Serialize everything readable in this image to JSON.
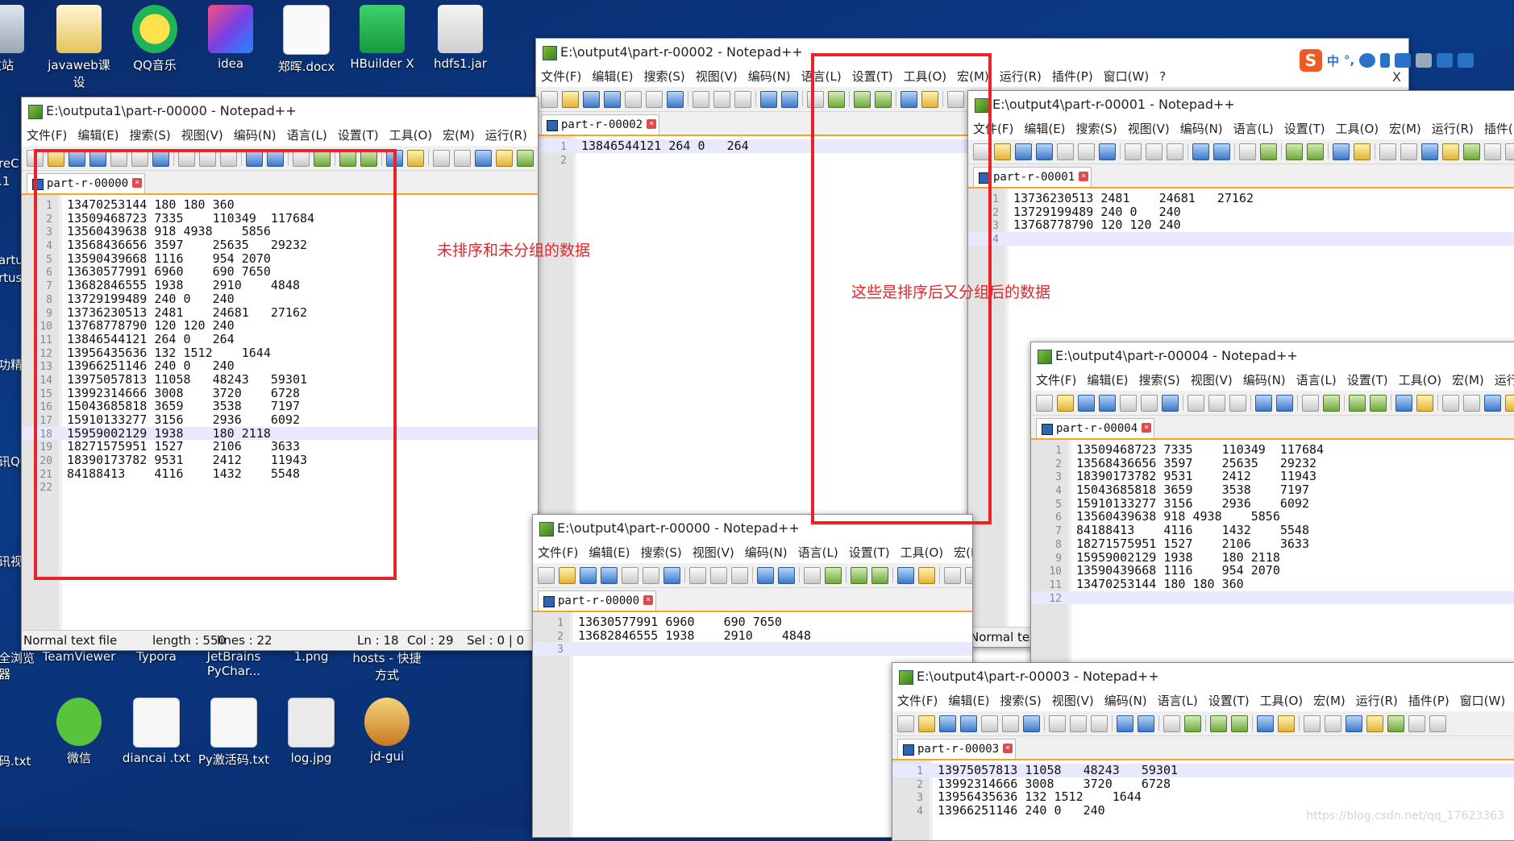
{
  "desktop_top_icons": [
    {
      "label": "收站",
      "icon": "recycle-bin-icon"
    },
    {
      "label": "javaweb课设",
      "icon": "folder-icon"
    },
    {
      "label": "QQ音乐",
      "icon": "qq-music-icon"
    },
    {
      "label": "idea",
      "icon": "intellij-idea-icon"
    },
    {
      "label": "郑晖.docx",
      "icon": "word-doc-icon"
    },
    {
      "label": "HBuilder X",
      "icon": "hbuilder-icon"
    },
    {
      "label": "hdfs1.jar",
      "icon": "java-jar-icon"
    }
  ],
  "desktop_left_edge_labels": [
    "reC",
    ".1",
    "artu",
    "rtus",
    "功精",
    "讯QQ",
    "讯视",
    "全浏览",
    "器",
    "码.txt"
  ],
  "desktop_bottom_row1": [
    {
      "label": "TeamViewer"
    },
    {
      "label": "Typora"
    },
    {
      "label": "JetBrains PyChar..."
    },
    {
      "label": "1.png"
    },
    {
      "label": "hosts - 快捷方式"
    }
  ],
  "desktop_bottom_row2": [
    {
      "label": "微信",
      "icon": "wechat-icon"
    },
    {
      "label": "diancai .txt",
      "icon": "text-file-icon"
    },
    {
      "label": "Py激活码.txt",
      "icon": "text-file-icon"
    },
    {
      "label": "log.jpg",
      "icon": "image-file-icon"
    },
    {
      "label": "jd-gui",
      "icon": "jd-gui-icon"
    }
  ],
  "menu_labels": [
    "文件(F)",
    "编辑(E)",
    "搜索(S)",
    "视图(V)",
    "编码(N)",
    "语言(L)",
    "设置(T)",
    "工具(O)",
    "宏(M)",
    "运行(R)",
    "插件(P)",
    "窗口(W)",
    "?"
  ],
  "win_main": {
    "title": "E:\\outputa1\\part-r-00000 - Notepad++",
    "tab": "part-r-00000",
    "lines": [
      "13470253144 180 180 360",
      "13509468723 7335    110349  117684",
      "13560439638 918 4938    5856",
      "13568436656 3597    25635   29232",
      "13590439668 1116    954 2070",
      "13630577991 6960    690 7650",
      "13682846555 1938    2910    4848",
      "13729199489 240 0   240",
      "13736230513 2481    24681   27162",
      "13768778790 120 120 240",
      "13846544121 264 0   264",
      "13956435636 132 1512    1644",
      "13966251146 240 0   240",
      "13975057813 11058   48243   59301",
      "13992314666 3008    3720    6728",
      "15043685818 3659    3538    7197",
      "15910133277 3156    2936    6092",
      "15959002129 1938    180 2118",
      "18271575951 1527    2106    3633",
      "18390173782 9531    2412    11943",
      "84188413    4116    1432    5548",
      ""
    ],
    "current_line": 18,
    "status": {
      "type": "Normal text file",
      "length": "length : 550",
      "lines": "lines : 22",
      "ln": "Ln : 18",
      "col": "Col : 29",
      "sel": "Sel : 0 | 0"
    }
  },
  "win_00002": {
    "title": "E:\\output4\\part-r-00002 - Notepad++",
    "tab": "part-r-00002",
    "lines": [
      "13846544121 264 0   264",
      ""
    ],
    "current_line": 1
  },
  "win_00001": {
    "title": "E:\\output4\\part-r-00001 - Notepad++",
    "tab": "part-r-00001",
    "lines": [
      "13736230513 2481    24681   27162",
      "13729199489 240 0   240",
      "13768778790 120 120 240",
      ""
    ],
    "current_line": 4,
    "status_type": "Normal tex"
  },
  "win_00004": {
    "title": "E:\\output4\\part-r-00004 - Notepad++",
    "tab": "part-r-00004",
    "lines": [
      "13509468723 7335    110349  117684",
      "13568436656 3597    25635   29232",
      "18390173782 9531    2412    11943",
      "15043685818 3659    3538    7197",
      "15910133277 3156    2936    6092",
      "13560439638 918 4938    5856",
      "84188413    4116    1432    5548",
      "18271575951 1527    2106    3633",
      "15959002129 1938    180 2118",
      "13590439668 1116    954 2070",
      "13470253144 180 180 360",
      ""
    ],
    "current_line": 12
  },
  "win_00000b": {
    "title": "E:\\output4\\part-r-00000 - Notepad++",
    "tab": "part-r-00000",
    "lines": [
      "13630577991 6960    690 7650",
      "13682846555 1938    2910    4848",
      ""
    ],
    "current_line": 3
  },
  "win_00003": {
    "title": "E:\\output4\\part-r-00003 - Notepad++",
    "tab": "part-r-00003",
    "lines": [
      "13975057813 11058   48243   59301",
      "13992314666 3008    3720    6728",
      "13956435636 132 1512    1644",
      "13966251146 240 0   240"
    ],
    "current_line": 1
  },
  "annotations": {
    "left": "未排序和未分组的数据",
    "right": "这些是排序后又分组后的数据"
  },
  "ime": {
    "zh": "中",
    "punct": "°,"
  },
  "close_x": "X",
  "watermark": "https://blog.csdn.net/qq_17623363",
  "colors": {
    "annotation_red": "#e8232a",
    "tab_accent": "#f7a520",
    "desktop_blue": "#0b3a86"
  }
}
